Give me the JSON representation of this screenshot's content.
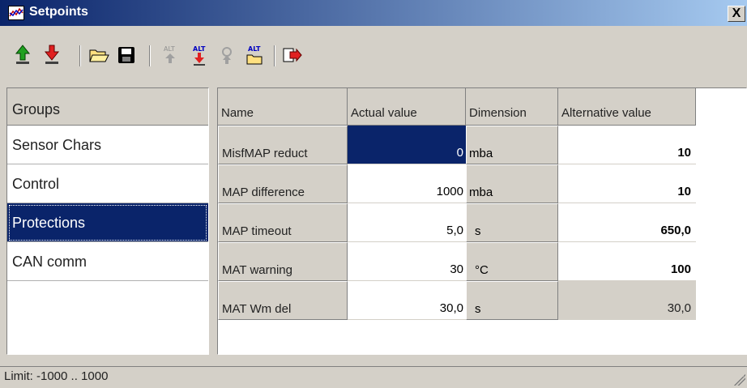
{
  "window": {
    "title": "Setpoints",
    "close_label": "X"
  },
  "toolbar": {
    "buttons": [
      {
        "icon": "upload-green-arrow-icon"
      },
      {
        "icon": "download-red-arrow-icon"
      },
      {
        "icon": "open-folder-icon"
      },
      {
        "icon": "save-disk-icon"
      },
      {
        "icon": "alt-disabled-icon",
        "label": "ALT"
      },
      {
        "icon": "alt-download-icon",
        "label": "ALT"
      },
      {
        "icon": "alt-disabled-2-icon"
      },
      {
        "icon": "alt-folder-icon",
        "label": "ALT"
      },
      {
        "icon": "export-arrow-icon"
      }
    ]
  },
  "groups": {
    "header": "Groups",
    "items": [
      "Sensor Chars",
      "Control",
      "Protections",
      "CAN comm"
    ],
    "selected": "Protections"
  },
  "table": {
    "columns": [
      "Name",
      "Actual value",
      "Dimension",
      "Alternative value"
    ],
    "rows": [
      {
        "name": "MisfMAP reduct",
        "value": "0",
        "dimension": "mba",
        "alt": "10"
      },
      {
        "name": "MAP difference",
        "value": "1000",
        "dimension": "mba",
        "alt": "10"
      },
      {
        "name": "MAP timeout",
        "value": "5,0",
        "dimension": "s",
        "alt": "650,0"
      },
      {
        "name": "MAT warning",
        "value": "30",
        "dimension": "°C",
        "alt": "100"
      },
      {
        "name": "MAT Wm del",
        "value": "30,0",
        "dimension": "s",
        "alt": "30,0"
      }
    ]
  },
  "status": {
    "text": "Limit: -1000 .. 1000"
  }
}
